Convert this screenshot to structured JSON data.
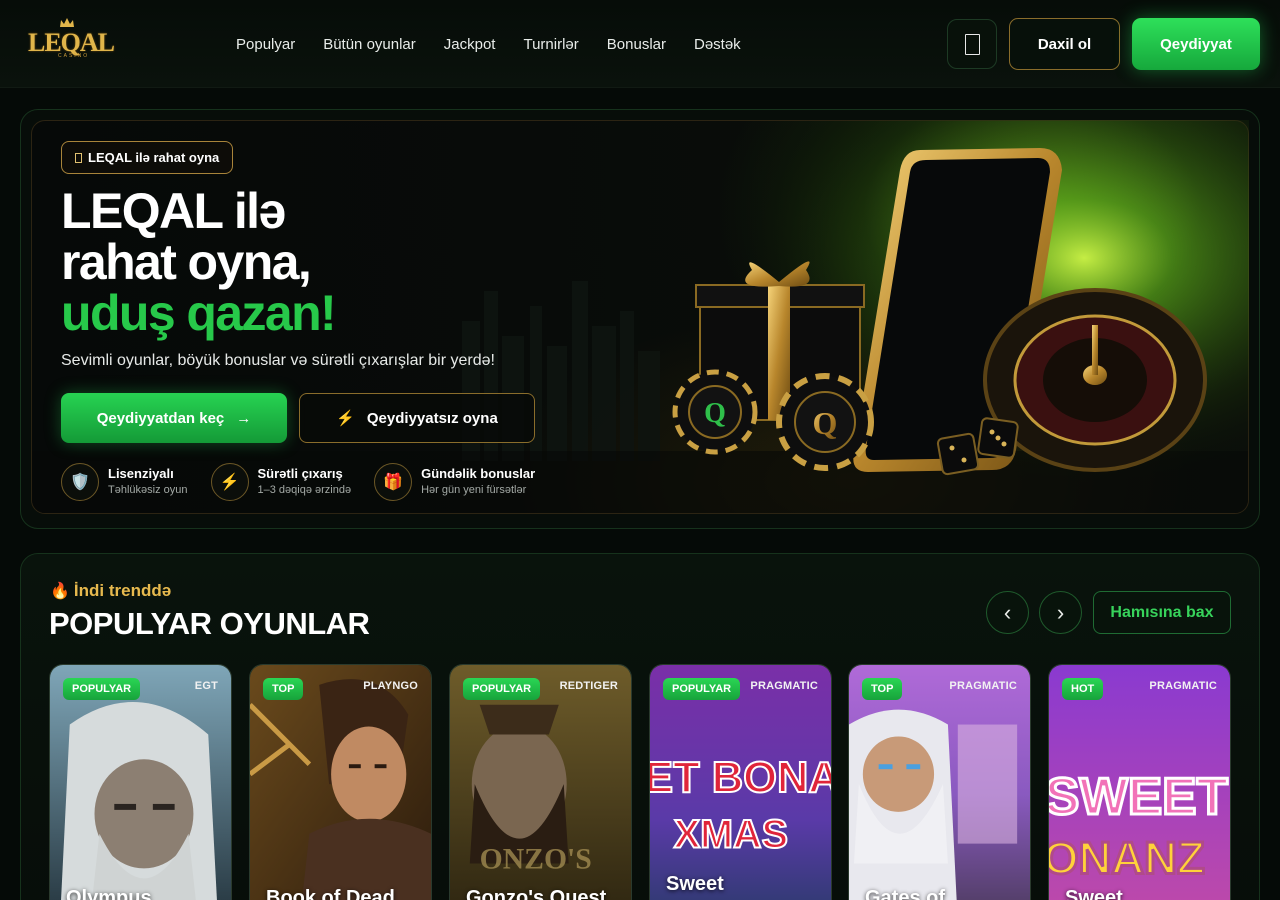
{
  "header": {
    "logo_text": "LEQAL",
    "logo_sub": "CASINO",
    "nav": [
      "Populyar",
      "Bütün oyunlar",
      "Jackpot",
      "Turnirlər",
      "Bonuslar",
      "Dəstək"
    ],
    "login_label": "Daxil ol",
    "register_label": "Qeydiyyat"
  },
  "hero": {
    "badge": "LEQAL ilə rahat oyna",
    "title_line1": "LEQAL ilə",
    "title_line2": "rahat oyna,",
    "title_line3": "uduş qazan!",
    "description": "Sevimli oyunlar, böyük bonuslar və sürətli çıxarışlar bir yerdə!",
    "cta_primary": "Qeydiyyatdan keç",
    "cta_primary_arrow": "→",
    "cta_secondary": "Qeydiyyatsız oyna",
    "cta_secondary_icon": "⚡",
    "features": [
      {
        "icon": "🛡️",
        "icon_name": "shield-icon",
        "title": "Lisenziyalı",
        "subtitle": "Təhlükəsiz oyun"
      },
      {
        "icon": "⚡",
        "icon_name": "lightning-icon",
        "title": "Sürətli çıxarış",
        "subtitle": "1–3 dəqiqə ərzində"
      },
      {
        "icon": "🎁",
        "icon_name": "gift-icon",
        "title": "Gündəlik bonuslar",
        "subtitle": "Hər gün yeni fürsətlər"
      }
    ]
  },
  "popular": {
    "trend_icon": "🔥",
    "trend_label": "İndi trenddə",
    "title": "POPULYAR OYUNLAR",
    "prev_label": "‹",
    "next_label": "›",
    "see_all_label": "Hamısına bax",
    "games": [
      {
        "tag": "POPULYAR",
        "provider": "EGT",
        "name": "Olympus"
      },
      {
        "tag": "TOP",
        "provider": "PLAYNGO",
        "name": "Book of Dead"
      },
      {
        "tag": "POPULYAR",
        "provider": "REDTIGER",
        "name": "Gonzo's Quest"
      },
      {
        "tag": "POPULYAR",
        "provider": "PRAGMATIC",
        "name": "Sweet"
      },
      {
        "tag": "TOP",
        "provider": "PRAGMATIC",
        "name": "Gates of"
      },
      {
        "tag": "HOT",
        "provider": "PRAGMATIC",
        "name": "Sweet"
      }
    ],
    "card_art_text": {
      "xmas_line1": "ET BONA",
      "xmas_line2": "XMAS",
      "sweet_line1": "SWEET",
      "sweet_line2": "ONANZ",
      "gonzo": "ONZO'S"
    }
  },
  "colors": {
    "accent_green": "#27c94a",
    "gold": "#e0b54a",
    "background": "#050a07"
  }
}
